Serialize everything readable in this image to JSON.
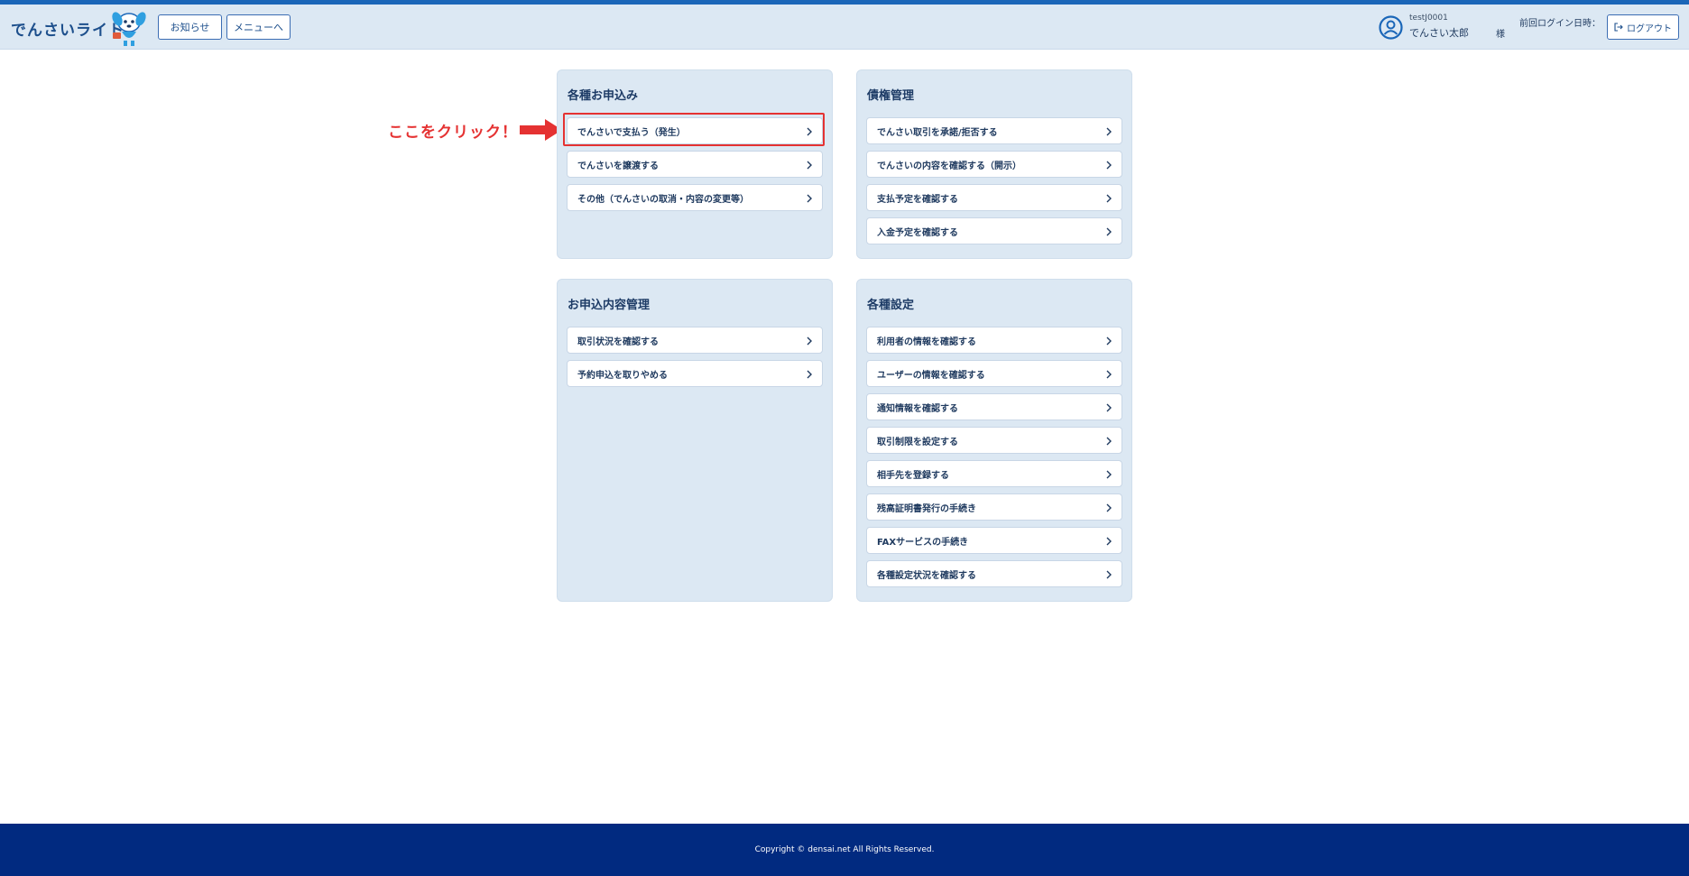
{
  "header": {
    "logo_text": "でんさいライト",
    "news_button": "お知らせ",
    "menu_button": "メニューへ",
    "user_id": "testJ0001",
    "user_name": "でんさい太郎",
    "honorific": "様",
    "last_login_label": "前回ログイン日時：",
    "logout_button": "ログアウト"
  },
  "annotation": {
    "callout": "ここをクリック！"
  },
  "panels": {
    "applications": {
      "title": "各種お申込み",
      "items": [
        "でんさいで支払う（発生）",
        "でんさいを譲渡する",
        "その他（でんさいの取消・内容の変更等）"
      ]
    },
    "claims": {
      "title": "債権管理",
      "items": [
        "でんさい取引を承諾/拒否する",
        "でんさいの内容を確認する（開示）",
        "支払予定を確認する",
        "入金予定を確認する"
      ]
    },
    "requests": {
      "title": "お申込内容管理",
      "items": [
        "取引状況を確認する",
        "予約申込を取りやめる"
      ]
    },
    "settings": {
      "title": "各種設定",
      "items": [
        "利用者の情報を確認する",
        "ユーザーの情報を確認する",
        "通知情報を確認する",
        "取引制限を設定する",
        "相手先を登録する",
        "残高証明書発行の手続き",
        "FAXサービスの手続き",
        "各種設定状況を確認する"
      ]
    }
  },
  "footer": {
    "copyright": "Copyright © densai.net All Rights Reserved."
  },
  "colors": {
    "header_bg": "#dce8f3",
    "accent": "#1a66b8",
    "footer_bg": "#012a80",
    "highlight": "#e53232"
  }
}
